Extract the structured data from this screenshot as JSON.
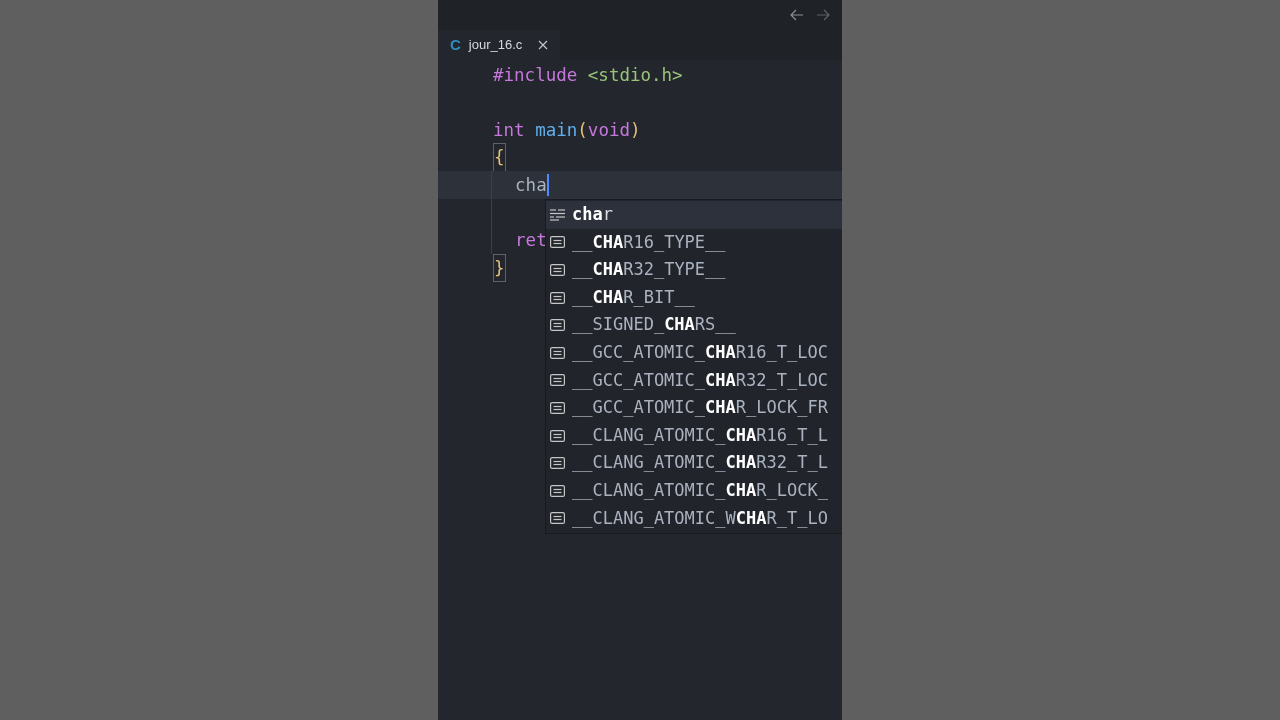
{
  "tabs": [
    {
      "label": "jour_16.c",
      "language_badge": "C",
      "selected": true
    }
  ],
  "editor": {
    "lines": [
      {
        "current": false,
        "tokens": [
          {
            "kind": "directive",
            "text": "#include"
          },
          {
            "kind": "string",
            "text": " <stdio.h>"
          }
        ]
      },
      {
        "current": false
      },
      {
        "current": false,
        "tokens": [
          {
            "kind": "keyword",
            "text": "int"
          },
          {
            "kind": "function",
            "text": " main"
          },
          {
            "kind": "bracket",
            "text": "("
          },
          {
            "kind": "keyword",
            "text": "void"
          },
          {
            "kind": "bracket",
            "text": ")"
          }
        ]
      },
      {
        "current": false,
        "tokens": [
          {
            "kind": "matched_bracket",
            "text": "{"
          }
        ]
      },
      {
        "current": true,
        "tokens": [
          {
            "kind": "plain",
            "text": "  cha"
          },
          {
            "kind": "cursor"
          }
        ]
      },
      {
        "current": false
      },
      {
        "current": false,
        "tokens": [
          {
            "kind": "keyword",
            "text": "  ret"
          }
        ]
      },
      {
        "current": false,
        "tokens": [
          {
            "kind": "matched_bracket",
            "text": "}"
          }
        ]
      }
    ]
  },
  "suggestions": [
    {
      "kind": "keyword",
      "label": "**cha**r",
      "selected": true
    },
    {
      "kind": "macro",
      "label": "__**CHA**R16_TYPE__",
      "selected": false
    },
    {
      "kind": "macro",
      "label": "__**CHA**R32_TYPE__",
      "selected": false
    },
    {
      "kind": "macro",
      "label": "__**CHA**R_BIT__",
      "selected": false
    },
    {
      "kind": "macro",
      "label": "__SIGNED_**CHA**RS__",
      "selected": false
    },
    {
      "kind": "macro",
      "label": "__GCC_ATOMIC_**CHA**R16_T_LOC",
      "selected": false
    },
    {
      "kind": "macro",
      "label": "__GCC_ATOMIC_**CHA**R32_T_LOC",
      "selected": false
    },
    {
      "kind": "macro",
      "label": "__GCC_ATOMIC_**CHA**R_LOCK_FR",
      "selected": false
    },
    {
      "kind": "macro",
      "label": "__CLANG_ATOMIC_**CHA**R16_T_L",
      "selected": false
    },
    {
      "kind": "macro",
      "label": "__CLANG_ATOMIC_**CHA**R32_T_L",
      "selected": false
    },
    {
      "kind": "macro",
      "label": "__CLANG_ATOMIC_**CHA**R_LOCK_",
      "selected": false
    },
    {
      "kind": "macro",
      "label": "__CLANG_ATOMIC_W**CHA**R_T_LO",
      "selected": false
    }
  ]
}
